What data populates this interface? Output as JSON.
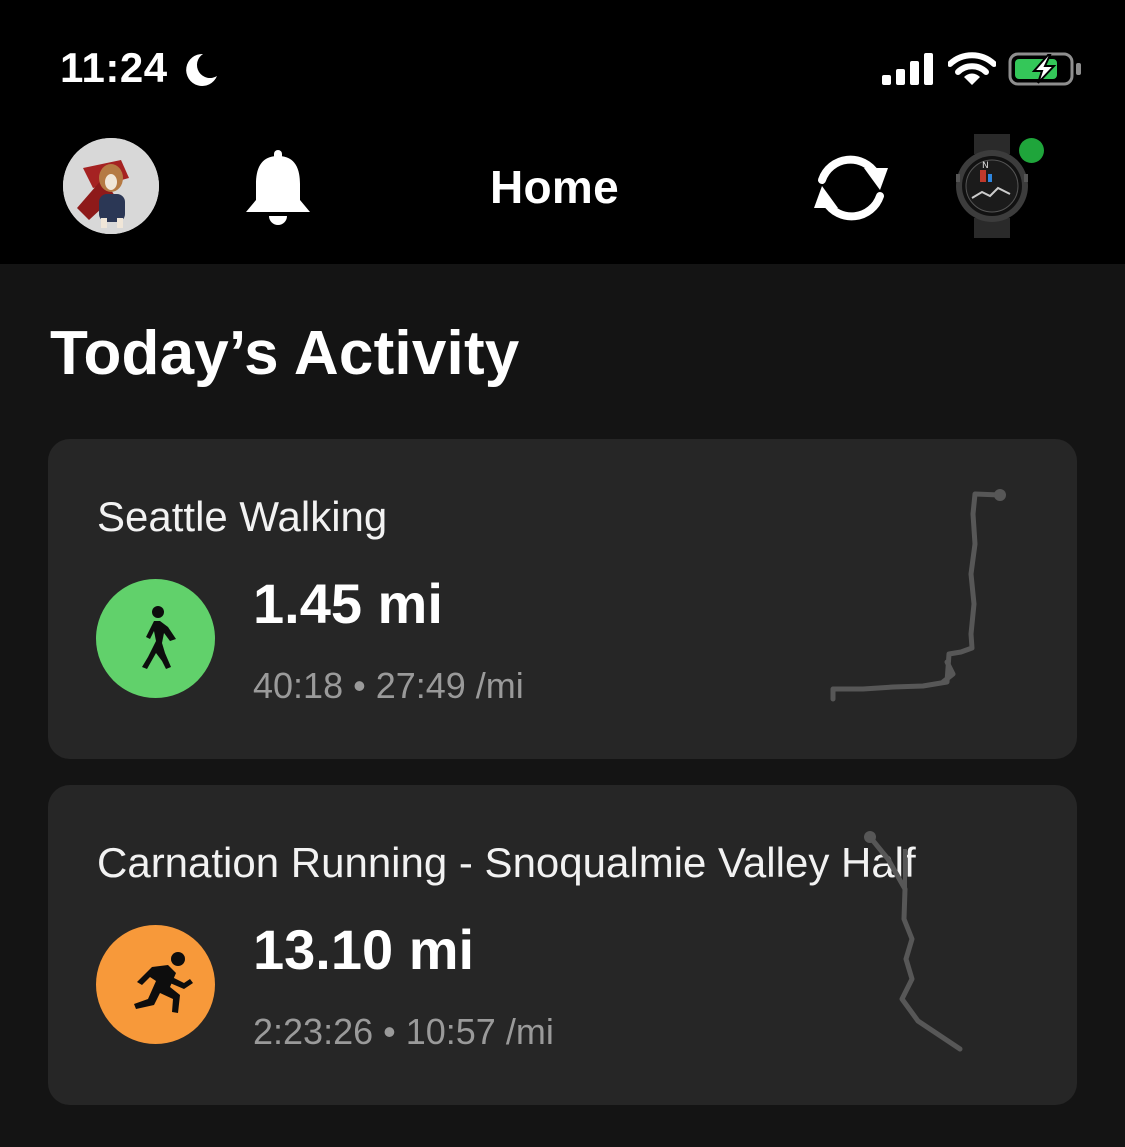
{
  "status_bar": {
    "time": "11:24",
    "focus_icon": "moon-icon",
    "signal_icon": "cellular-signal-icon",
    "wifi_icon": "wifi-icon",
    "battery_icon": "battery-charging-icon",
    "battery_color": "#34c759"
  },
  "nav": {
    "title": "Home",
    "avatar_icon": "user-avatar",
    "notifications_icon": "bell-icon",
    "sync_icon": "sync-icon",
    "device_icon": "watch-device-icon",
    "device_status_color": "#1fa53b"
  },
  "section": {
    "title": "Today’s Activity"
  },
  "activities": [
    {
      "name": "Seattle Walking",
      "type_icon": "walking-icon",
      "icon_color": "#61d16b",
      "distance": "1.45 mi",
      "duration": "40:18",
      "separator": "•",
      "pace": "27:49 /mi",
      "map_icon": "route-map"
    },
    {
      "name": "Carnation Running - Snoqualmie Valley Half",
      "type_icon": "running-icon",
      "icon_color": "#f7993a",
      "distance": "13.10 mi",
      "duration": "2:23:26",
      "separator": "•",
      "pace": "10:57 /mi",
      "map_icon": "route-map"
    }
  ]
}
